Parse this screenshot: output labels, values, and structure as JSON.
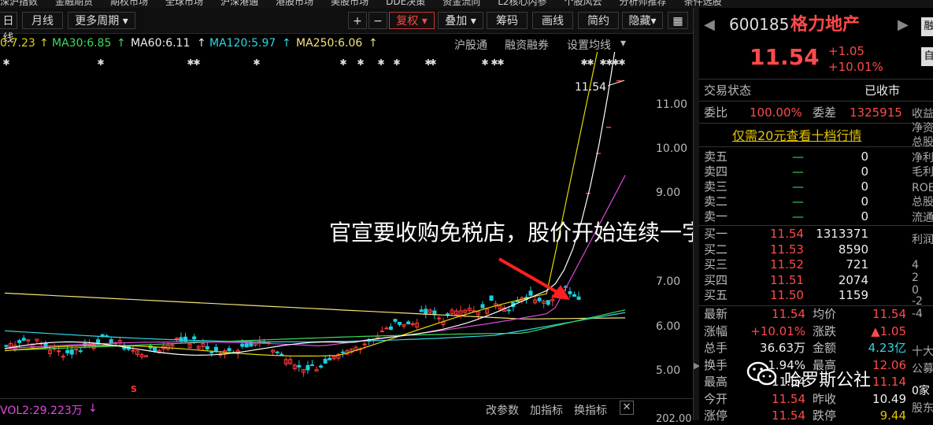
{
  "top_menu": [
    "深沪指数",
    "金融期货",
    "期权市场",
    "全球市场",
    "沪深港通",
    "港股市场",
    "美股市场",
    "DDE决策",
    "资金流向",
    "L2核心内参",
    "个股风云",
    "分析师推荐",
    "条件选股"
  ],
  "toolbar": {
    "day_label": "日线",
    "month_label": "月线",
    "more_period_label": "更多周期",
    "plus": "+",
    "minus": "−",
    "fuquan_label": "复权",
    "overlay_label": "叠加",
    "chips_label": "筹码",
    "drawline_label": "画线",
    "simple_label": "简约",
    "hide_label": "隐藏",
    "grid_icon": "grid-icon"
  },
  "ma_bar": {
    "ma10": "0:7.23",
    "ma30": "MA30:6.85",
    "ma60": "MA60:6.11",
    "ma120": "MA120:5.97",
    "ma250": "MA250:6.06",
    "link1": "沪股通",
    "link2": "融资融券",
    "link3": "设置均线"
  },
  "chart_data": {
    "type": "candlestick",
    "y_ticks": [
      "11.00",
      "10.00",
      "9.00",
      "7.00",
      "6.00",
      "5.00"
    ],
    "last_price_label": "11.54",
    "annotation": "官宣要收购免税店，股价开始连续一字板",
    "vol_label": "VOL2:29.223万",
    "vol_links": [
      "改参数",
      "加指标",
      "换指标"
    ],
    "vol_tick": "202.00",
    "colors": {
      "up": "#ff3b3b",
      "down": "#18d0e0",
      "ma5": "#ffffff",
      "ma10": "#e6d800",
      "ma30": "#e04ae0",
      "ma60": "#3ddc5a",
      "ma120": "#2dd6e6",
      "ma250": "#f5e27a"
    }
  },
  "panel": {
    "code": "600185",
    "name": "格力地产",
    "price": "11.54",
    "change": "+1.05",
    "change_pct": "+10.01%",
    "trade_status_label": "交易状态",
    "trade_status": "已收市",
    "weibi_label": "委比",
    "weibi": "100.00%",
    "weicha_label": "委差",
    "weicha": "1325915",
    "promo": "仅需20元查看十档行情",
    "sell": [
      {
        "l": "卖五",
        "p": "—",
        "v": "0"
      },
      {
        "l": "卖四",
        "p": "—",
        "v": "0"
      },
      {
        "l": "卖三",
        "p": "—",
        "v": "0"
      },
      {
        "l": "卖二",
        "p": "—",
        "v": "0"
      },
      {
        "l": "卖一",
        "p": "—",
        "v": "0"
      }
    ],
    "buy": [
      {
        "l": "买一",
        "p": "11.54",
        "v": "1313371"
      },
      {
        "l": "买二",
        "p": "11.53",
        "v": "8590"
      },
      {
        "l": "买三",
        "p": "11.52",
        "v": "721"
      },
      {
        "l": "买四",
        "p": "11.51",
        "v": "2074"
      },
      {
        "l": "买五",
        "p": "11.50",
        "v": "1159"
      }
    ],
    "stats": [
      {
        "l1": "最新",
        "v1": "11.54",
        "l2": "均价",
        "v2": "11.54"
      },
      {
        "l1": "涨幅",
        "v1": "+10.01%",
        "l2": "涨跌",
        "v2": "▲1.05"
      },
      {
        "l1": "总手",
        "v1": "36.63万",
        "l2": "金额",
        "v2": "4.23亿"
      },
      {
        "l1": "换手",
        "v1": "1.94%",
        "l2": "最高",
        "v2": "12.06"
      },
      {
        "l1": "最高",
        "v1": "11.54",
        "l2": "",
        "v2": "11.14"
      },
      {
        "l1": "今开",
        "v1": "11.54",
        "l2": "昨收",
        "v2": "10.49"
      },
      {
        "l1": "涨停",
        "v1": "11.54",
        "l2": "跌停",
        "v2": "9.44"
      }
    ],
    "far_right": [
      "收益",
      "净资",
      "总股",
      "净利",
      "毛利",
      "ROE",
      "总股",
      "流通",
      "利润",
      "4",
      "2",
      "0",
      "-2",
      "-4",
      "十大",
      "公募",
      "0家",
      "股东"
    ],
    "watermark": "哈罗斯公社"
  }
}
